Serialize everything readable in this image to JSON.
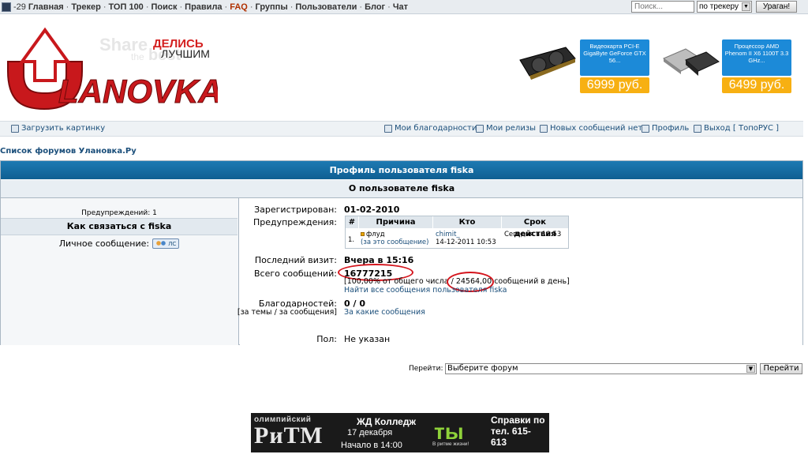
{
  "topbar": {
    "count": "-29",
    "links": [
      "Главная",
      "Трекер",
      "ТОП 100",
      "Поиск",
      "Правила",
      "FAQ",
      "Группы",
      "Пользователи",
      "Блог",
      "Чат"
    ],
    "search_placeholder": "Поиск...",
    "search_scope": "по трекеру",
    "search_button": "Ураган!"
  },
  "header": {
    "logo_share": "Share",
    "logo_the": "the",
    "logo_best": "best",
    "logo_delis": "ДЕЛИСЬ",
    "logo_luchshim": "ЛУЧШИМ",
    "logo_name": "LANOVKA",
    "ads": [
      {
        "text": "Видеокарта PCI-E GigaByte GeForce GTX 56...",
        "price": "6999 руб."
      },
      {
        "text": "Процессор AMD Phenom II X6 1100T 3.3 GHz...",
        "price": "6499 руб."
      }
    ]
  },
  "userbar": {
    "upload": "Загрузить картинку",
    "thanks": "Мои благодарности",
    "releases": "Мои релизы",
    "new_posts": "Новых сообщений нет",
    "profile": "Профиль",
    "logout": "Выход [ ТопоРУС ]"
  },
  "breadcrumb": "Список форумов Улановка.Ру",
  "profile": {
    "title": "Профиль пользователя fiska",
    "about_title": "О пользователе fiska",
    "warnings_count": "Предупреждений: 1",
    "contact_title": "Как связаться с fiska",
    "pm_label": "Личное сообщение:",
    "pm_button": "ЛС",
    "registered_label": "Зарегистрирован:",
    "registered_value": "01-02-2010",
    "warnings_label": "Предупреждения:",
    "warnings_table": {
      "headers": [
        "#",
        "Причина",
        "Кто",
        "Срок действия"
      ],
      "rows": [
        {
          "num": "1.",
          "reason": "флуд",
          "reason_link": "(за это сообщение)",
          "who": "chimit_",
          "when": "14-12-2011 10:53",
          "expires": "Сегодня в 10:53"
        }
      ]
    },
    "last_visit_label": "Последний визит:",
    "last_visit_value": "Вчера в 15:16",
    "total_posts_label": "Всего сообщений:",
    "total_posts_value": "16777215",
    "posts_stats_a": "[100,00% от общего числа /",
    "posts_stats_rate": "24564,00",
    "posts_stats_b": "сообщений в день]",
    "find_posts": "Найти все сообщения пользователя fiska",
    "thanks_label": "Благодарностей:",
    "thanks_sub_label": "[за темы / за сообщения]",
    "thanks_value": "0 / 0",
    "thanks_link": "За какие сообщения",
    "gender_label": "Пол:",
    "gender_value": "Не указан"
  },
  "jump": {
    "label": "Перейти:",
    "select": "Выберите форум",
    "button": "Перейти"
  },
  "banner": {
    "line1": "олимпийский",
    "line2": "РиТМ",
    "line3": "ЖД Колледж",
    "line4": "17 декабря",
    "line5": "Начало в 14:00",
    "line6": "ты",
    "line7": "В ритме жизни!",
    "line8": "Справки по тел. 615-613"
  }
}
